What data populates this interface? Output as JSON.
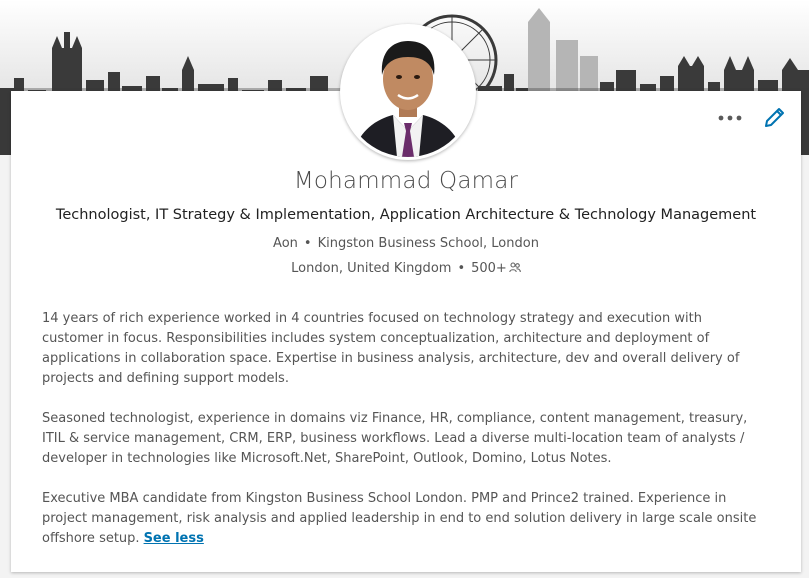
{
  "profile": {
    "name": "Mohammad Qamar",
    "headline": "Technologist, IT Strategy & Implementation, Application Architecture & Technology Management",
    "company": "Aon",
    "school": "Kingston Business School, London",
    "location": "London, United Kingdom",
    "connections": "500+",
    "connections_icon": "people-icon",
    "summary": [
      "14 years of rich experience worked in 4 countries focused on technology strategy and execution with customer in focus. Responsibilities includes system conceptualization, architecture and deployment of applications in collaboration space. Expertise in business analysis, architecture, dev and overall delivery of projects and defining support models.",
      "Seasoned technologist, experience in domains viz Finance, HR, compliance, content management, treasury, ITIL & service management, CRM, ERP, business workflows. Lead a diverse multi-location team of analysts / developer in technologies like Microsoft.Net, SharePoint, Outlook, Domino, Lotus Notes.",
      "Executive MBA candidate from Kingston Business School London. PMP and Prince2 trained. Experience in project management, risk analysis and applied leadership in end to end solution delivery in large scale onsite offshore setup."
    ],
    "see_less_label": "See less"
  },
  "actions": {
    "more_icon": "more-horizontal-icon",
    "edit_icon": "pencil-icon"
  },
  "colors": {
    "link": "#0073b1",
    "banner_gray": "#d8d8d8",
    "text_secondary": "#555555"
  }
}
